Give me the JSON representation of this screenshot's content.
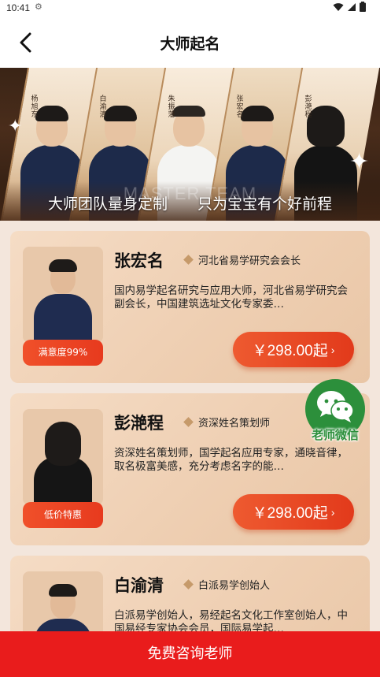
{
  "status_bar": {
    "time": "10:41"
  },
  "nav": {
    "title": "大师起名"
  },
  "banner": {
    "watermark": "MASTER TEAM",
    "slogan_left": "大师团队量身定制",
    "slogan_right": "只为宝宝有个好前程",
    "masters": [
      "杨旭东",
      "白渝清",
      "朱振藩",
      "张宏名",
      "彭滟程"
    ]
  },
  "cards": [
    {
      "name": "张宏名",
      "title": "河北省易学研究会会长",
      "desc": "国内易学起名研究与应用大师，河北省易学研究会副会长，中国建筑选址文化专家委…",
      "badge": "满意度99%",
      "price": "￥298.00起"
    },
    {
      "name": "彭滟程",
      "title": "资深姓名策划师",
      "desc": "资深姓名策划师，国学起名应用专家，通晓音律，取名极富美感，充分考虑名字的能…",
      "badge": "低价特惠",
      "price": "￥298.00起"
    },
    {
      "name": "白渝清",
      "title": "白派易学创始人",
      "desc": "白派易学创始人，易经起名文化工作室创始人，中国易经专家协会会员，国际易学起…",
      "badge": "",
      "price": ""
    }
  ],
  "wechat": {
    "label": "老师微信",
    "color": "#2c8f3b"
  },
  "bottom_cta": {
    "label": "免费咨询老师",
    "color": "#e91c1c"
  },
  "accent": "#e23a1b"
}
